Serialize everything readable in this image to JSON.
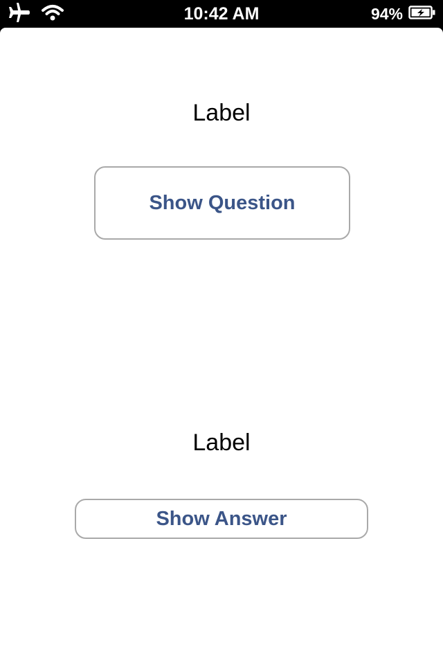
{
  "status_bar": {
    "left_icons": [
      "airplane-icon",
      "wifi-icon"
    ],
    "time": "10:42 AM",
    "battery_percent": "94%",
    "battery_icon": "battery-charging-icon"
  },
  "main": {
    "question_label": "Label",
    "show_question_button": "Show Question",
    "answer_label": "Label",
    "show_answer_button": "Show Answer"
  },
  "colors": {
    "button_text": "#3b5588",
    "button_border": "#a9a9a9",
    "status_bar_bg": "#000000",
    "screen_bg": "#ffffff"
  }
}
